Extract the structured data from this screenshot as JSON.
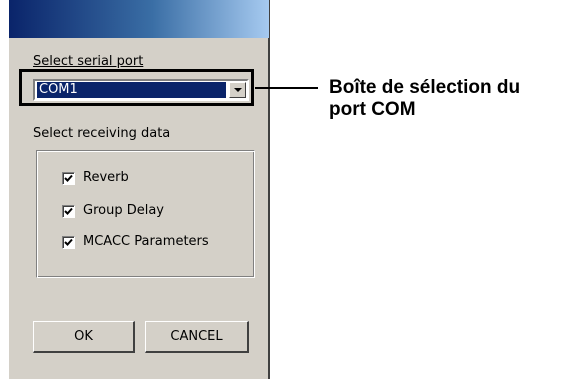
{
  "serial_port": {
    "label": "Select serial port",
    "selected": "COM1"
  },
  "receiving": {
    "label": "Select receiving data",
    "options": [
      {
        "label": "Reverb",
        "checked": true
      },
      {
        "label": "Group Delay",
        "checked": true
      },
      {
        "label": "MCACC Parameters",
        "checked": true
      }
    ]
  },
  "buttons": {
    "ok": "OK",
    "cancel": "CANCEL"
  },
  "callout": {
    "line1": "Boîte de sélection du",
    "line2": "port COM"
  }
}
